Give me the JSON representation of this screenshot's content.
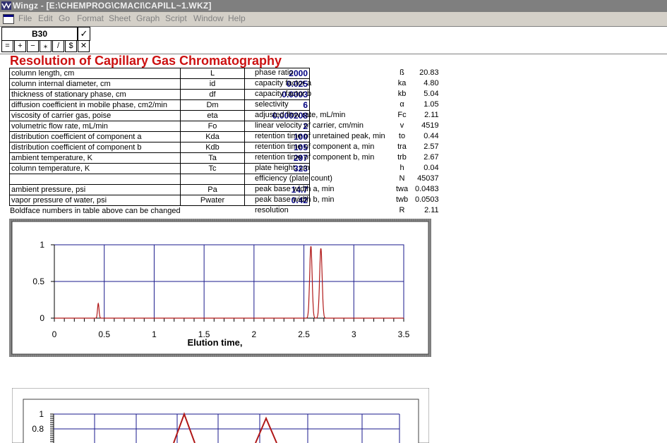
{
  "window": {
    "title": "Wingz - [E:\\CHEMPROG\\CMACI\\CAPILL~1.WKZ]"
  },
  "menu": [
    "File",
    "Edit",
    "Go",
    "Format",
    "Sheet",
    "Graph",
    "Script",
    "Window",
    "Help"
  ],
  "formula_bar": {
    "cell": "B30",
    "accept": "✓",
    "cancel": "✕",
    "operators": [
      "=",
      "+",
      "−",
      "⁎",
      "/",
      "$"
    ]
  },
  "sheet": {
    "title": "Resolution of Capillary Gas Chromatography",
    "note": "Boldface numbers in table above can be changed",
    "parameters": [
      {
        "label": "column length, cm",
        "symbol": "L",
        "value": "2000"
      },
      {
        "label": "column internal diameter, cm",
        "symbol": "id",
        "value": "0.025"
      },
      {
        "label": "thickness of stationary phase, cm",
        "symbol": "df",
        "value": "0.0003"
      },
      {
        "label": "diffusion coefficient in mobile phase, cm2/min",
        "symbol": "Dm",
        "value": "6"
      },
      {
        "label": "viscosity of carrier gas,  poise",
        "symbol": "eta",
        "value": "0.000208"
      },
      {
        "label": "volumetric flow rate, mL/min",
        "symbol": "Fo",
        "value": "2"
      },
      {
        "label": "distribution coefficient of component a",
        "symbol": "Kda",
        "value": "100"
      },
      {
        "label": "distribution coefficient of component b",
        "symbol": "Kdb",
        "value": "105"
      },
      {
        "label": "ambient temperature, K",
        "symbol": "Ta",
        "value": "297"
      },
      {
        "label": "column temperature, K",
        "symbol": "Tc",
        "value": "323"
      },
      {
        "label": "",
        "symbol": "",
        "value": ""
      },
      {
        "label": "ambient pressure, psi",
        "symbol": "Pa",
        "value": "14.7"
      },
      {
        "label": "vapor pressure of water, psi",
        "symbol": "Pwater",
        "value": "0.42"
      }
    ],
    "results": [
      {
        "label": "phase ratio",
        "symbol": "ß",
        "value": "20.83"
      },
      {
        "label": "capacity factor a",
        "symbol": "ka",
        "value": "4.80"
      },
      {
        "label": "capacity factor b",
        "symbol": "kb",
        "value": "5.04"
      },
      {
        "label": "selectivity",
        "symbol": "α",
        "value": "1.05"
      },
      {
        "label": "adjusted flow rate, mL/min",
        "symbol": "Fc",
        "value": "2.11"
      },
      {
        "label": "linear velocity of carrier, cm/min",
        "symbol": "v",
        "value": "4519"
      },
      {
        "label": "retention time of unretained peak, min",
        "symbol": "to",
        "value": "0.44"
      },
      {
        "label": "retention time of component a, min",
        "symbol": "tra",
        "value": "2.57"
      },
      {
        "label": "retention time of component b, min",
        "symbol": "trb",
        "value": "2.67"
      },
      {
        "label": "plate height, cm",
        "symbol": "h",
        "value": "0.04"
      },
      {
        "label": "efficiency (plate count)",
        "symbol": "N",
        "value": "45037"
      },
      {
        "label": "peak base width a, min",
        "symbol": "twa",
        "value": "0.0483"
      },
      {
        "label": "peak base width b, min",
        "symbol": "twb",
        "value": "0.0503"
      },
      {
        "label": "resolution",
        "symbol": "R",
        "value": "2.11"
      }
    ]
  },
  "colors": {
    "heading": "#cc1111",
    "curve": "#b01818",
    "grid": "#1a1a8c",
    "frame": "#808080"
  },
  "chart_data": [
    {
      "type": "line",
      "xlabel": "Elution time,",
      "xlim": [
        0,
        3.5
      ],
      "ylim": [
        0,
        1
      ],
      "xticks": [
        "0",
        "0.5",
        "1",
        "1.5",
        "2",
        "2.5",
        "3",
        "3.5"
      ],
      "yticks": [
        "0",
        "0.5",
        "1"
      ],
      "peaks": [
        {
          "center": 0.44,
          "width": 0.03,
          "height": 0.2
        },
        {
          "center": 2.57,
          "width": 0.0483,
          "height": 0.98
        },
        {
          "center": 2.67,
          "width": 0.0503,
          "height": 0.95
        }
      ]
    },
    {
      "type": "line",
      "ylim": [
        0,
        1
      ],
      "yticks": [
        "1",
        "0.8"
      ],
      "peaks_visible": 2
    }
  ]
}
